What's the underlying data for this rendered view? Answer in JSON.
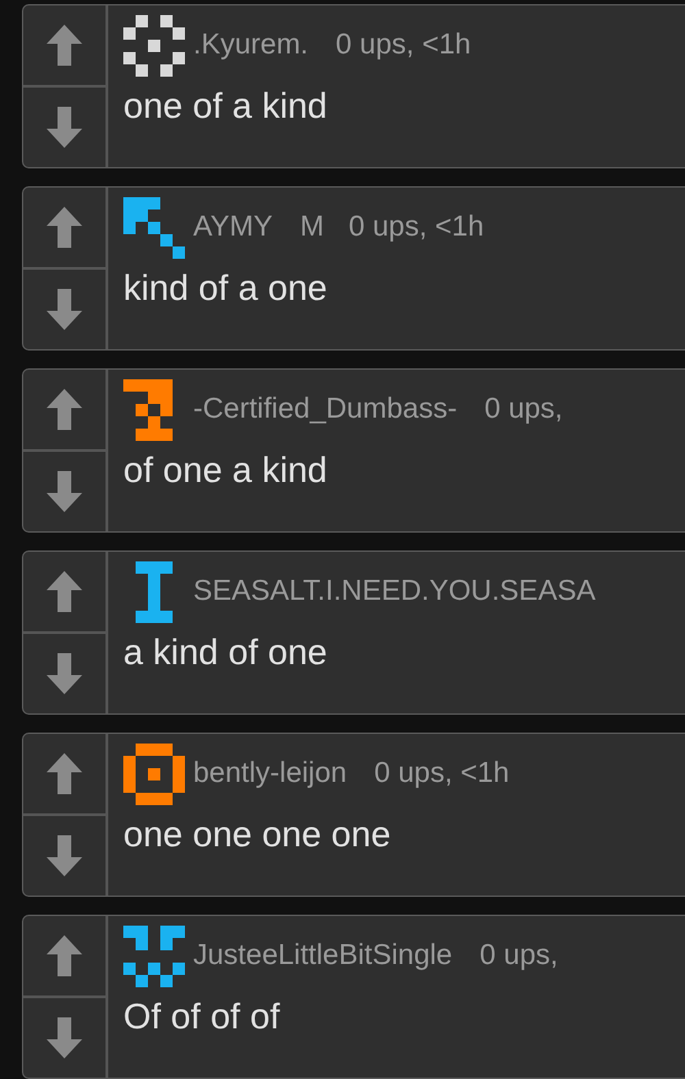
{
  "comments": [
    {
      "color": "#d8d8d8",
      "user": ".Kyurem.",
      "meta": "0 ups, <1h",
      "text": "one of a kind"
    },
    {
      "color": "#1ab2f0",
      "user": "AYMY",
      "flair": "M",
      "meta": "0 ups, <1h",
      "text": "kind of a one"
    },
    {
      "color": "#ff7b00",
      "user": "-Certified_Dumbass-",
      "meta": "0 ups,",
      "text": "of one a kind"
    },
    {
      "color": "#1ab2f0",
      "user": "SEASALT.I.NEED.YOU.SEASA",
      "text": "a kind of one"
    },
    {
      "color": "#ff7b00",
      "user": "bently-leijon",
      "meta": "0 ups, <1h",
      "text": "one one one one"
    },
    {
      "color": "#1ab2f0",
      "user": "JusteeLittleBitSingle",
      "meta": "0 ups,",
      "text": "Of of of of"
    }
  ]
}
